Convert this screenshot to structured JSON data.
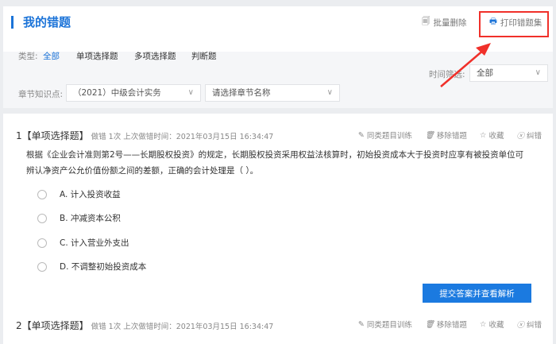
{
  "header": {
    "title": "我的错题",
    "batch_delete": "批量删除",
    "print": "打印错题集"
  },
  "filters": {
    "type_label": "类型:",
    "types": [
      "全部",
      "单项选择题",
      "多项选择题",
      "判断题"
    ],
    "time_label": "时间筛选:",
    "time_value": "全部",
    "chapter_label": "章节知识点:",
    "subject_value": "（2021）中级会计实务",
    "chapter_placeholder": "请选择章节名称"
  },
  "accent": "#1b73d8",
  "questions": [
    {
      "num": "1",
      "type": "【单项选择题】",
      "meta": "做错 1次 上次做错时间：2021年03月15日 16:34:47",
      "stem": "根据《企业会计准则第2号——长期股权投资》的规定，长期股权投资采用权益法核算时，初始投资成本大于投资时应享有被投资单位可辨认净资产公允价值份额之间的差额，正确的会计处理是（ ）。",
      "options": [
        "A. 计入投资收益",
        "B. 冲减资本公积",
        "C. 计入营业外支出",
        "D. 不调整初始投资成本"
      ]
    },
    {
      "num": "2",
      "type": "【单项选择题】",
      "meta": "做错 1次 上次做错时间：2021年03月15日 16:34:47"
    }
  ],
  "actions": {
    "similar": "同类题目训练",
    "remove": "移除错题",
    "favorite": "收藏",
    "report": "纠错"
  },
  "submit": "提交答案并查看解析"
}
